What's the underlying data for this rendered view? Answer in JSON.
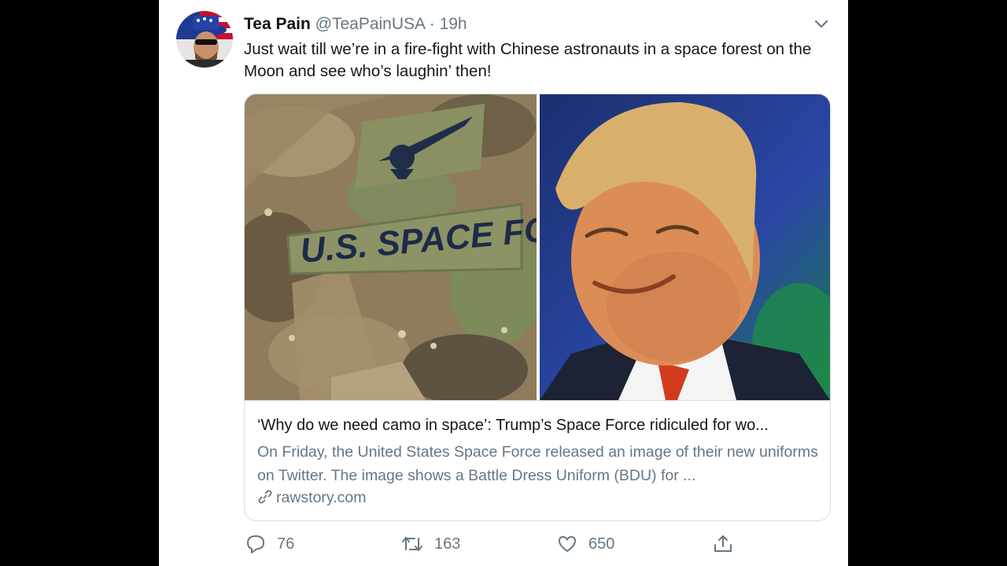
{
  "tweet": {
    "display_name": "Tea Pain",
    "handle": "@TeaPainUSA",
    "separator": "·",
    "time": "19h",
    "text": "Just wait till we’re in a fire-fight with Chinese astronauts in a space forest on the Moon and see who’s laughin’ then!",
    "more_icon": "chevron-down-icon"
  },
  "card": {
    "title": "‘Why do we need camo in space’: Trump’s Space Force ridiculed for wo...",
    "description": "On Friday, the United States Space Force released an image of their new uniforms on Twitter. The image shows a Battle Dress Uniform (BDU) for ...",
    "domain": "rawstory.com",
    "patch_text": "U.S. SPACE FORCE"
  },
  "actions": {
    "reply_count": "76",
    "retweet_count": "163",
    "like_count": "650"
  },
  "colors": {
    "background": "#000000",
    "panel": "#ffffff",
    "text": "#14171a",
    "secondary": "#657786",
    "border": "#d5dde3"
  }
}
